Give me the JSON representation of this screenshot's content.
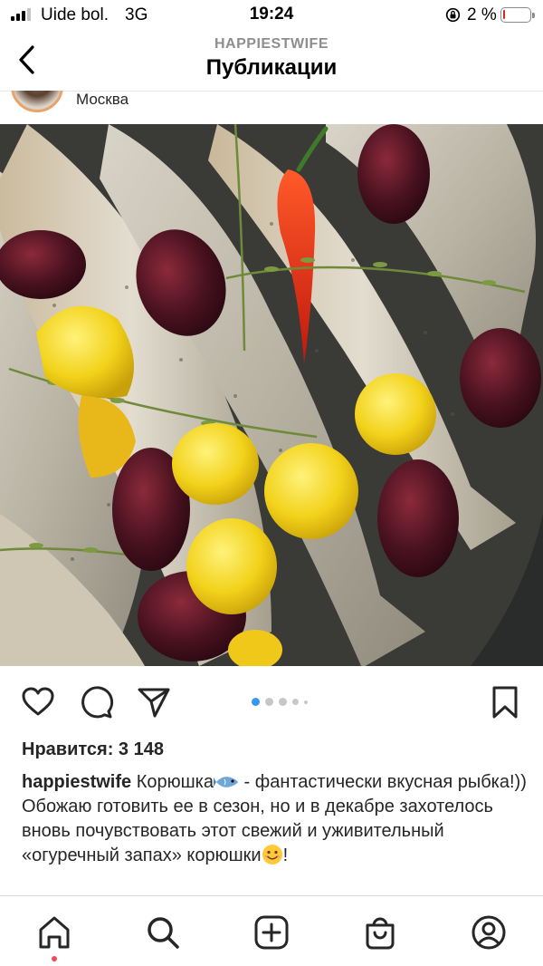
{
  "status_bar": {
    "carrier": "Uide bol.",
    "network": "3G",
    "time": "19:24",
    "battery_percent": "2 %",
    "battery_color": "#e0201a"
  },
  "header": {
    "username": "HAPPIESTWIFE",
    "title": "Публикации",
    "back_icon": "chevron-left-icon"
  },
  "post": {
    "location": "Москва",
    "image_description_icon": "photo",
    "carousel": {
      "count": 5,
      "active_index": 0
    },
    "likes_text": "Нравится: 3 148",
    "caption": {
      "username": "happiestwife",
      "line1": "Корюшка",
      "line1_rest": " - фантастически вкусная рыбка!))",
      "line2": "Обожаю готовить ее в сезон, но и в декабре захотелось вновь почувствовать этот свежий и уживительный «огуречный запах» корюшки",
      "line2_end": "!"
    }
  },
  "actions": {
    "like_icon": "heart-icon",
    "comment_icon": "comment-icon",
    "share_icon": "send-icon",
    "save_icon": "bookmark-icon"
  },
  "tabbar": {
    "items": [
      "home-icon",
      "search-icon",
      "new-post-icon",
      "shop-icon",
      "profile-icon"
    ],
    "notification_color": "#ed4956"
  },
  "colors": {
    "accent_blue": "#3797f0",
    "text": "#262626",
    "muted": "#8e8e8e"
  }
}
